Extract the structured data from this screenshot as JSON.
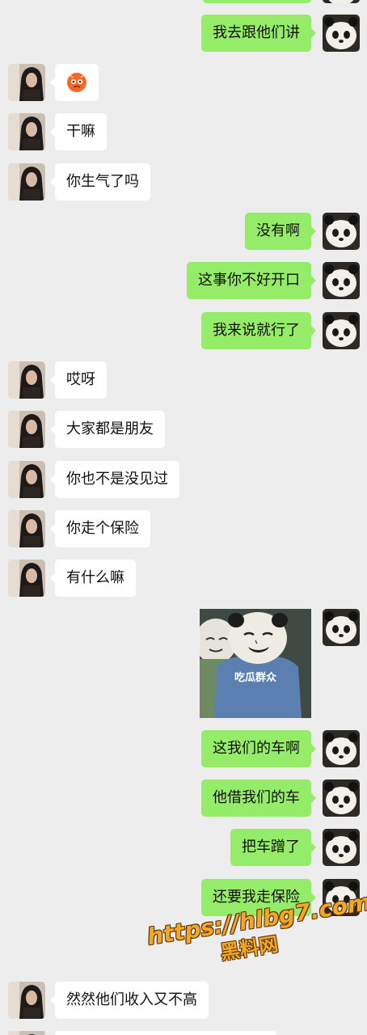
{
  "colors": {
    "background": "#ededed",
    "sent_bubble": "#95ec69",
    "received_bubble": "#ffffff",
    "watermark": "#f5a623"
  },
  "messages": [
    {
      "side": "right",
      "type": "text",
      "text": "我去跟他们讲"
    },
    {
      "side": "left",
      "type": "emoji",
      "icon": "shy-blush-emoji-icon"
    },
    {
      "side": "left",
      "type": "text",
      "text": "干嘛"
    },
    {
      "side": "left",
      "type": "text",
      "text": "你生气了吗"
    },
    {
      "side": "right",
      "type": "text",
      "text": "没有啊"
    },
    {
      "side": "right",
      "type": "text",
      "text": "这事你不好开口"
    },
    {
      "side": "right",
      "type": "text",
      "text": "我来说就行了"
    },
    {
      "side": "left",
      "type": "text",
      "text": "哎呀"
    },
    {
      "side": "left",
      "type": "text",
      "text": "大家都是朋友"
    },
    {
      "side": "left",
      "type": "text",
      "text": "你也不是没见过"
    },
    {
      "side": "left",
      "type": "text",
      "text": "你走个保险"
    },
    {
      "side": "left",
      "type": "text",
      "text": "有什么嘛"
    },
    {
      "side": "right",
      "type": "sticker",
      "text": "吃瓜群众",
      "icon": "panda-meme-sticker"
    },
    {
      "side": "right",
      "type": "text",
      "text": "这我们的车啊"
    },
    {
      "side": "right",
      "type": "text",
      "text": "他借我们的车"
    },
    {
      "side": "right",
      "type": "text",
      "text": "把车蹭了"
    },
    {
      "side": "right",
      "type": "text",
      "text": "还要我走保险"
    },
    {
      "side": "left",
      "type": "text",
      "text": "然然他们收入又不高"
    }
  ],
  "watermark": {
    "url": "https://hlbg7.com",
    "name": "黑料网"
  }
}
